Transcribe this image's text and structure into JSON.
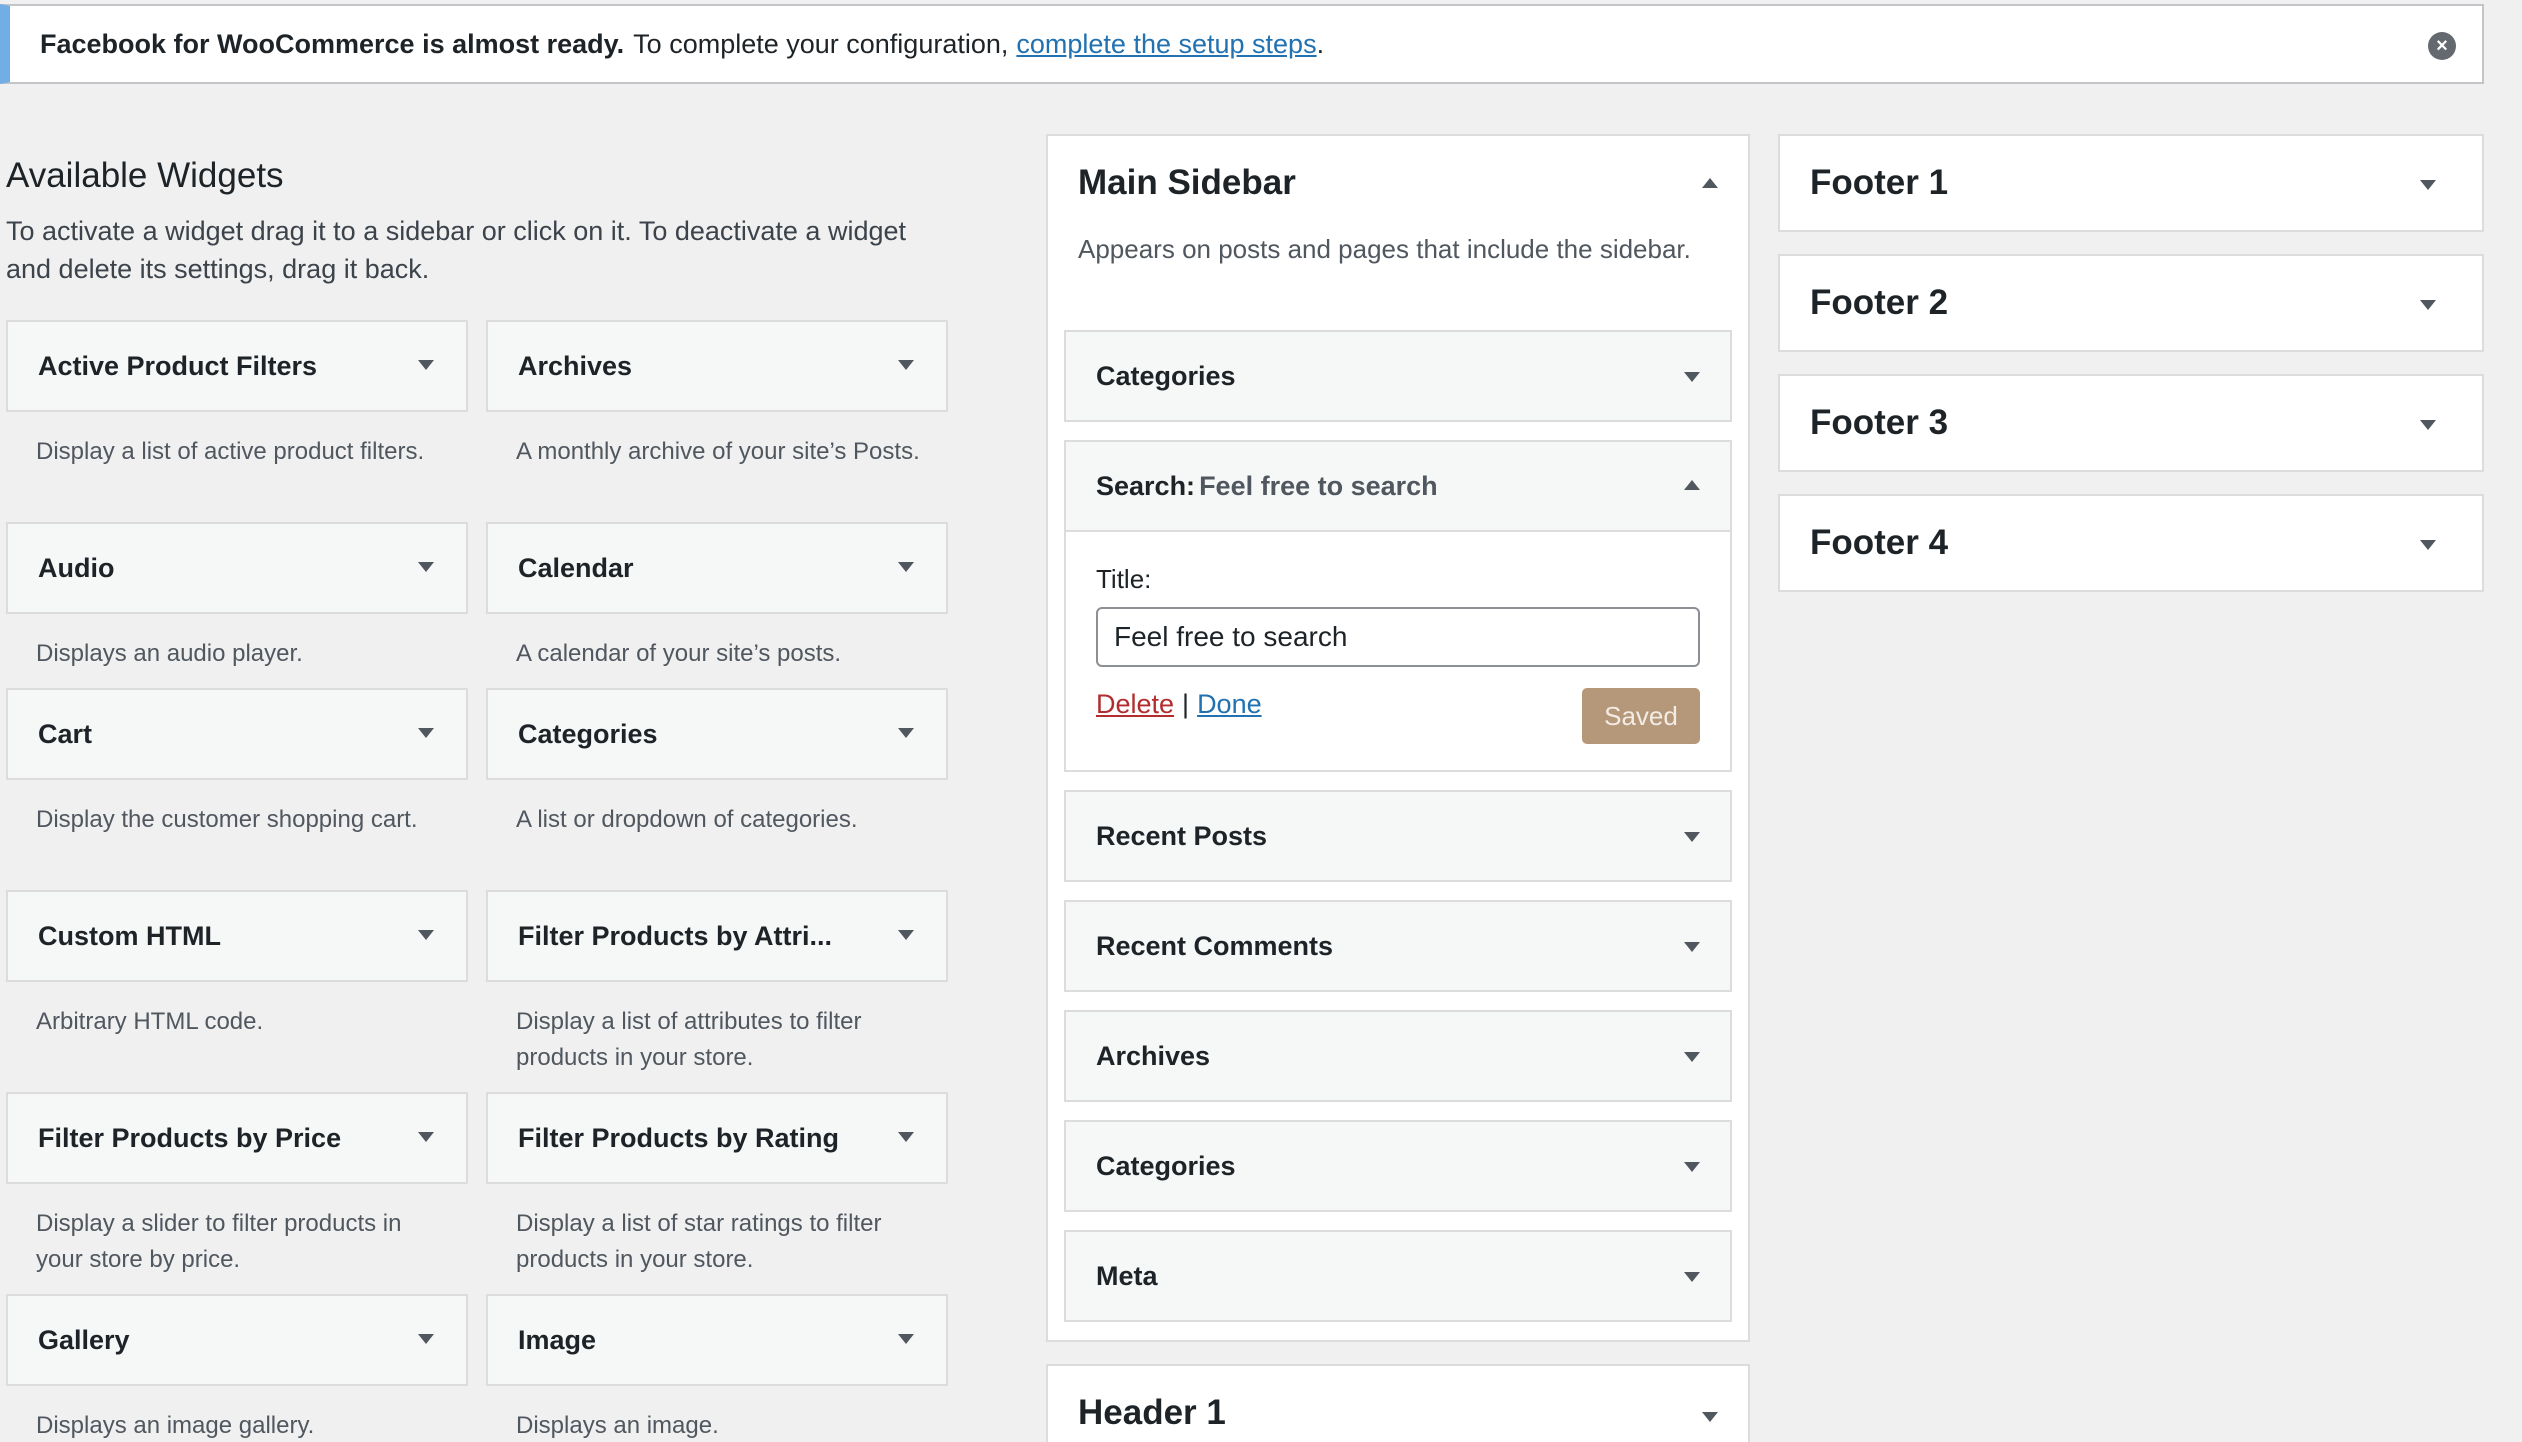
{
  "notice": {
    "strong": "Facebook for WooCommerce is almost ready.",
    "text": "To complete your configuration,",
    "link": "complete the setup steps",
    "after": ".",
    "close_glyph": "×"
  },
  "available": {
    "title": "Available Widgets",
    "description": "To activate a widget drag it to a sidebar or click on it. To deactivate a widget and delete its settings, drag it back."
  },
  "widgets": [
    {
      "name": "Active Product Filters",
      "desc": "Display a list of active product filters."
    },
    {
      "name": "Archives",
      "desc": "A monthly archive of your site’s Posts."
    },
    {
      "name": "Audio",
      "desc": "Displays an audio player."
    },
    {
      "name": "Calendar",
      "desc": "A calendar of your site’s posts."
    },
    {
      "name": "Cart",
      "desc": "Display the customer shopping cart."
    },
    {
      "name": "Categories",
      "desc": "A list or dropdown of categories."
    },
    {
      "name": "Custom HTML",
      "desc": "Arbitrary HTML code."
    },
    {
      "name": "Filter Products by Attri...",
      "desc": "Display a list of attributes to filter products in your store."
    },
    {
      "name": "Filter Products by Price",
      "desc": "Display a slider to filter products in your store by price."
    },
    {
      "name": "Filter Products by Rating",
      "desc": "Display a list of star ratings to filter products in your store."
    },
    {
      "name": "Gallery",
      "desc": "Displays an image gallery."
    },
    {
      "name": "Image",
      "desc": "Displays an image."
    }
  ],
  "main_sidebar": {
    "title": "Main Sidebar",
    "description": "Appears on posts and pages that include the sidebar.",
    "widgets": [
      "Categories",
      "Recent Posts",
      "Recent Comments",
      "Archives",
      "Categories",
      "Meta"
    ],
    "search_widget": {
      "name": "Search:",
      "subtitle": "Feel free to search",
      "title_label": "Title:",
      "title_value": "Feel free to search",
      "delete": "Delete",
      "separator": "|",
      "done": "Done",
      "saved": "Saved"
    }
  },
  "header1": {
    "title": "Header 1"
  },
  "footers": [
    "Footer 1",
    "Footer 2",
    "Footer 3",
    "Footer 4"
  ],
  "colors": {
    "notice_accent": "#72aee6",
    "link": "#2271b1",
    "delete": "#b32d2e",
    "saved_button": "#b5977a"
  }
}
